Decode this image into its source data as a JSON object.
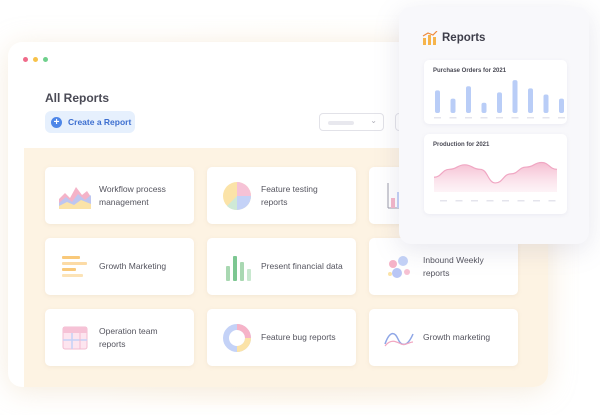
{
  "window": {
    "dots": [
      "#f06b8a",
      "#f7c24a",
      "#6fd08c"
    ]
  },
  "main": {
    "title": "All Reports",
    "create_button": "Create a Report"
  },
  "cards": [
    {
      "label": "Workflow process management",
      "icon": "area-chart-icon"
    },
    {
      "label": "Feature testing reports",
      "icon": "pie-chart-icon"
    },
    {
      "label": "",
      "icon": "bar-chart-icon"
    },
    {
      "label": "Growth Marketing",
      "icon": "horizontal-bars-icon"
    },
    {
      "label": "Present financial data",
      "icon": "column-chart-icon"
    },
    {
      "label": "Inbound Weekly reports",
      "icon": "bubble-chart-icon"
    },
    {
      "label": "Operation team reports",
      "icon": "table-icon"
    },
    {
      "label": "Feature bug reports",
      "icon": "donut-chart-icon"
    },
    {
      "label": "Growth marketing",
      "icon": "line-chart-icon"
    }
  ],
  "panel": {
    "title": "Reports",
    "purchase_title": "Purchase Orders for 2021",
    "production_title": "Production for 2021"
  },
  "chart_data": [
    {
      "type": "bar",
      "title": "Purchase Orders for 2021",
      "categories": [
        "",
        "",
        "",
        "",
        "",
        "",
        "",
        "",
        ""
      ],
      "values": [
        22,
        14,
        26,
        10,
        20,
        32,
        24,
        18,
        14
      ],
      "color": "#b9cdf7"
    },
    {
      "type": "area",
      "title": "Production for 2021",
      "x": [
        1,
        2,
        3,
        4,
        5,
        6,
        7,
        8,
        9
      ],
      "values": [
        13,
        20,
        24,
        20,
        8,
        16,
        22,
        26,
        20
      ],
      "color": "#f0a7c3"
    }
  ]
}
